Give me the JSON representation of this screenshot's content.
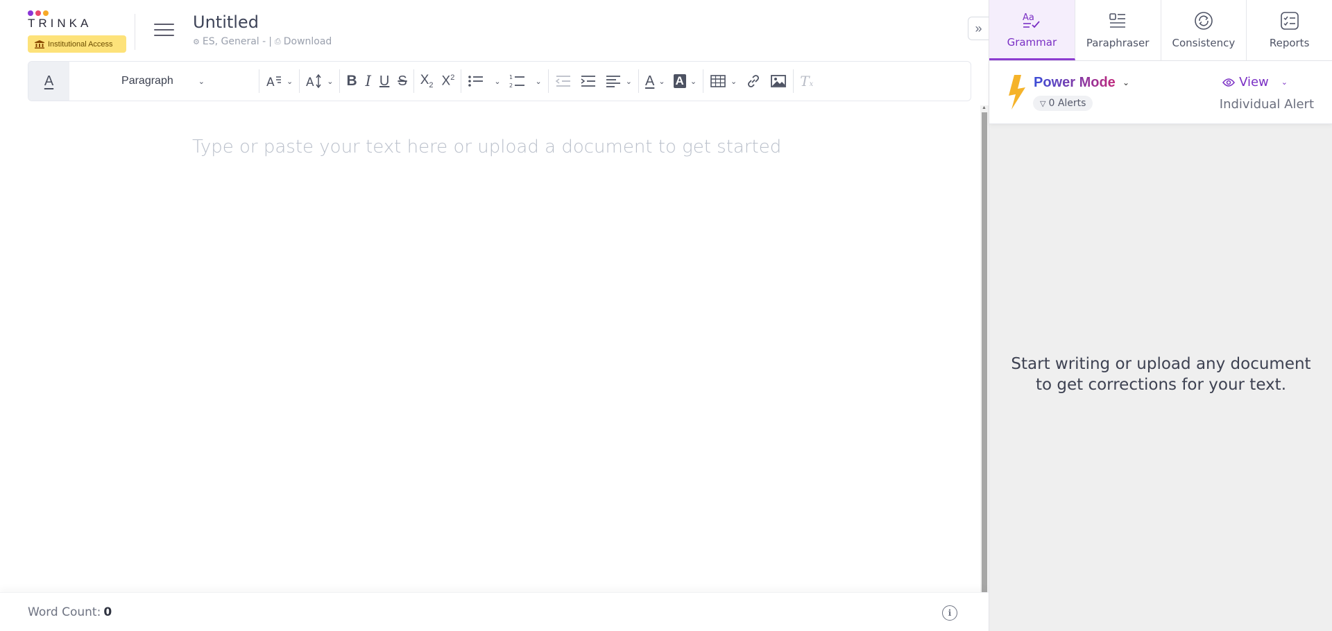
{
  "brand": {
    "logo_text": "TRINKA",
    "institutional_badge": "Institutional Access",
    "dot_colors": [
      "#8a35d6",
      "#e9476a",
      "#f7a928"
    ]
  },
  "document": {
    "title": "Untitled",
    "meta_lang": "ES, General -",
    "meta_sep": "|",
    "download_label": "Download"
  },
  "toolbar": {
    "block_format": "Paragraph",
    "font_style_icon": "text-style-icon",
    "font_size_icon": "text-size-icon",
    "bold_icon": "B",
    "italic_icon": "I",
    "underline_icon": "U",
    "strike_icon": "S"
  },
  "editor": {
    "placeholder": "Type or paste your text here or upload a document to get started"
  },
  "footer": {
    "word_count_label": "Word Count:",
    "word_count_value": "0",
    "info_icon": "i"
  },
  "panel": {
    "tabs": [
      {
        "label": "Grammar",
        "icon": "grammar-icon",
        "active": true
      },
      {
        "label": "Paraphraser",
        "icon": "paraphraser-icon",
        "active": false
      },
      {
        "label": "Consistency",
        "icon": "consistency-icon",
        "active": false
      },
      {
        "label": "Reports",
        "icon": "reports-icon",
        "active": false
      }
    ],
    "mode_label": "Power Mode",
    "alerts_label": "0 Alerts",
    "view_label": "View",
    "view_sub": "Individual Alert",
    "empty_line1": "Start writing or upload any document",
    "empty_line2": "to get corrections for your text.",
    "accent_color": "#7a2fc4"
  }
}
